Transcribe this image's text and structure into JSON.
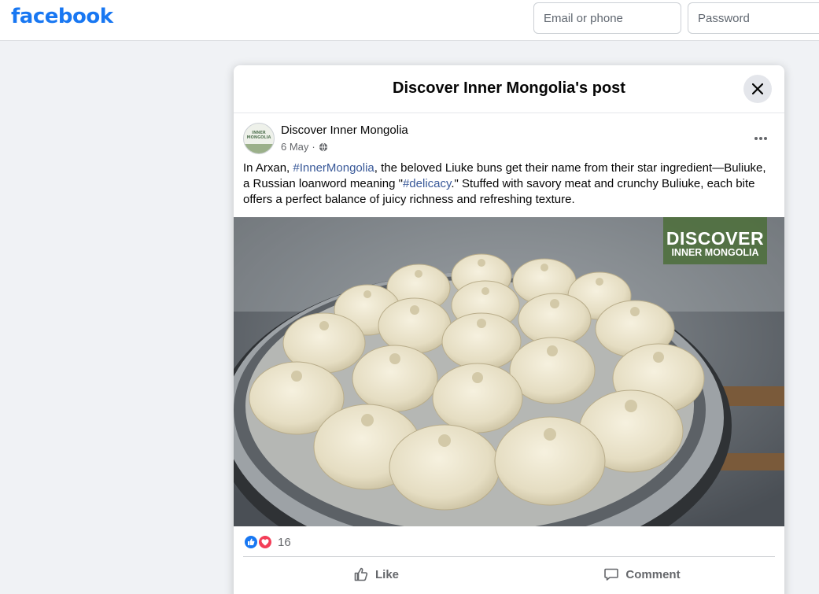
{
  "brand": {
    "logo_text": "facebook",
    "color": "#1877f2"
  },
  "login": {
    "email_placeholder": "Email or phone",
    "password_placeholder": "Password"
  },
  "modal": {
    "title": "Discover Inner Mongolia's post",
    "close_icon": "close-icon"
  },
  "post": {
    "avatar_text": "INNER MONGOLIA",
    "author": "Discover Inner Mongolia",
    "date": "6 May",
    "separator": "·",
    "audience_icon": "globe-icon",
    "more_icon": "more-icon",
    "text": {
      "part1": "In Arxan, ",
      "hashtag1": "#InnerMongolia",
      "part2": ", the beloved Liuke buns get their name from their star ingredient—Buliuke, a Russian loanword meaning \"",
      "hashtag2": "#delicacy",
      "part3": ".\" Stuffed with savory meat and crunchy Buliuke, each bite offers a perfect balance of juicy richness and refreshing texture."
    },
    "image": {
      "watermark_line1": "DISCOVER",
      "watermark_line2": "INNER MONGOLIA"
    },
    "reactions": {
      "types": [
        "like",
        "love"
      ],
      "count": "16"
    },
    "actions": {
      "like_label": "Like",
      "comment_label": "Comment"
    }
  }
}
